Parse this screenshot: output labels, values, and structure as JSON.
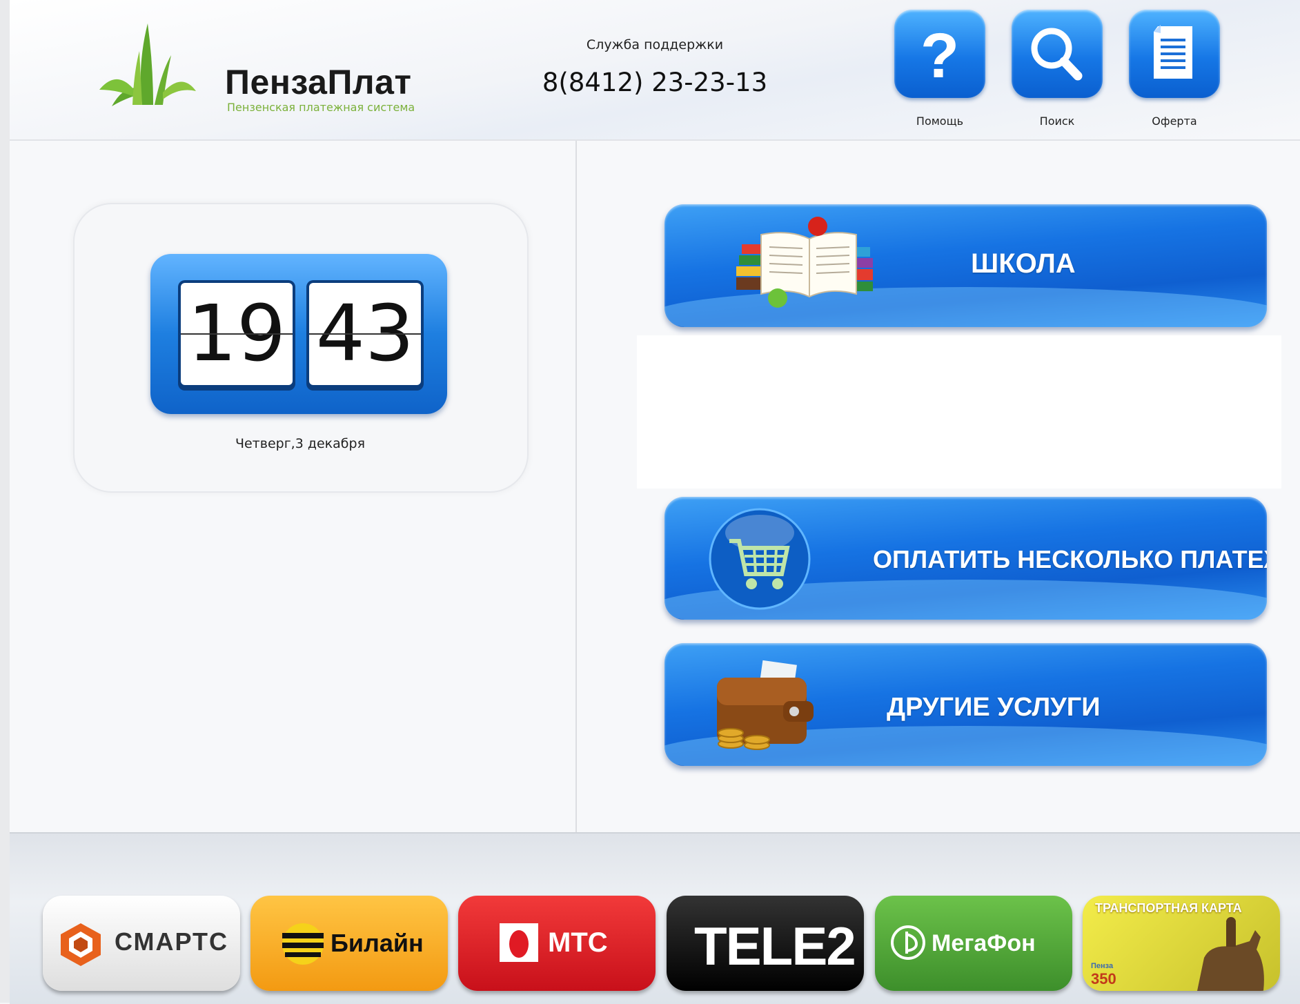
{
  "header": {
    "logo_name": "ПензаПлат",
    "logo_tagline": "Пензенская платежная система",
    "support_label": "Служба поддержки",
    "support_phone": "8(8412) 23-23-13",
    "buttons": [
      {
        "label": "Помощь",
        "icon": "question-icon"
      },
      {
        "label": "Поиск",
        "icon": "search-icon"
      },
      {
        "label": "Оферта",
        "icon": "document-icon"
      }
    ]
  },
  "clock": {
    "hours": "19",
    "minutes": "43",
    "date": "Четверг,3 декабря"
  },
  "menu": {
    "school": "ШКОЛА",
    "multi_pay": "ОПЛАТИТЬ НЕСКОЛЬКО ПЛАТЕЖЕЙ",
    "other": "ДРУГИЕ УСЛУГИ"
  },
  "operators": [
    {
      "label": "СМАРТС",
      "bg": "#f2f2f2"
    },
    {
      "label": "Билайн",
      "bg": "#f7a81f"
    },
    {
      "label": "МТС",
      "bg": "#e01a24"
    },
    {
      "label": "TELE2",
      "bg": "#0a0a0a"
    },
    {
      "label": "МегаФон",
      "bg": "#4ea83a"
    },
    {
      "label": "ТРАНСПОРТНАЯ КАРТА",
      "sub_number": "350",
      "sub_city": "Пенза",
      "bg": "#e9de3a"
    }
  ],
  "colors": {
    "button_blue": "#1673e3",
    "logo_green": "#7bb13a"
  }
}
